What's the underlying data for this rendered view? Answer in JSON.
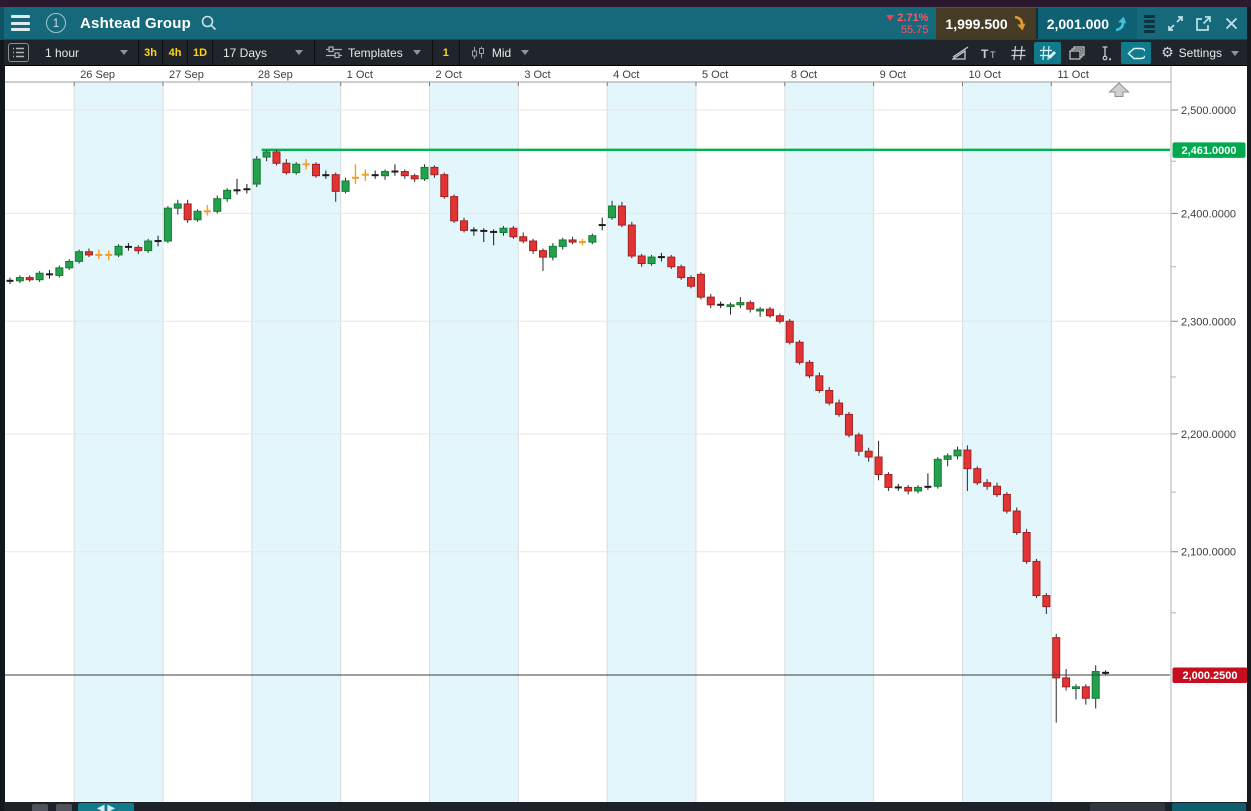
{
  "header": {
    "badge": "1",
    "title": "Ashtead Group",
    "change_glyph": "▼",
    "change_pct": "2.71%",
    "change_abs": "55.75",
    "sell": "1,999.500",
    "buy": "2,001.000",
    "accent_teal": "#15697a",
    "change_color": "#ff5560"
  },
  "toolbar": {
    "interval": "1 hour",
    "quick_intervals": [
      "3h",
      "4h",
      "1D"
    ],
    "range": "17 Days",
    "templates": "Templates",
    "count": "1",
    "price_type": "Mid",
    "settings": "Settings",
    "highlight_color": "#0f7b8c",
    "accent_yellow": "#ffd60a"
  },
  "chart_data": {
    "type": "candlestick",
    "instrument": "Ashtead Group",
    "interval": "1 hour",
    "range": "17 Days",
    "price_basis": "Mid",
    "y_axis": {
      "scale": "log",
      "ticks": [
        "2,500.0000",
        "2,400.0000",
        "2,300.0000",
        "2,200.0000",
        "2,100.0000"
      ],
      "tick_values": [
        2500,
        2400,
        2300,
        2200,
        2100
      ],
      "minor_ticks": [
        2450,
        2350,
        2250,
        2150,
        2050
      ]
    },
    "levels": {
      "high_line": {
        "value": 2461.0,
        "label": "2,461.0000",
        "line_color": "#00b34d",
        "badge_color": "#00a94e"
      },
      "last_price": {
        "value": 2000.25,
        "label": "2,000.2500",
        "line_color": "#3c3c3c",
        "badge_color": "#c50e1f"
      }
    },
    "style": {
      "up": "#23a14d",
      "up_border": "#147a35",
      "down": "#e23434",
      "down_border": "#a32121",
      "doji": "#f59d25",
      "neutral": "#1b1b1b",
      "band": "#e2f6fb",
      "grid": "#e7e7e7",
      "vgrid": "#dcdcdc",
      "wick": "#2a2a2a"
    },
    "days": [
      {
        "label": "",
        "shaded": false,
        "candles": [
          [
            2337,
            2340,
            2334,
            2337,
            "k"
          ],
          [
            2337,
            2342,
            2335,
            2340
          ],
          [
            2340,
            2342,
            2336,
            2338
          ],
          [
            2338,
            2346,
            2336,
            2344
          ],
          [
            2344,
            2347,
            2339,
            2342,
            "k"
          ],
          [
            2342,
            2351,
            2340,
            2349
          ],
          [
            2349,
            2357,
            2347,
            2355
          ]
        ]
      },
      {
        "label": "26 Sep",
        "shaded": true,
        "candles": [
          [
            2355,
            2366,
            2353,
            2364
          ],
          [
            2364,
            2367,
            2359,
            2361
          ],
          [
            2361,
            2366,
            2357,
            2361,
            "a"
          ],
          [
            2361,
            2365,
            2356,
            2361,
            "a"
          ],
          [
            2361,
            2371,
            2359,
            2369
          ],
          [
            2369,
            2372,
            2365,
            2368,
            "k"
          ],
          [
            2368,
            2370,
            2362,
            2365
          ],
          [
            2365,
            2376,
            2363,
            2374
          ],
          [
            2374,
            2379,
            2369,
            2374,
            "k"
          ]
        ]
      },
      {
        "label": "27 Sep",
        "shaded": false,
        "candles": [
          [
            2374,
            2407,
            2372,
            2405
          ],
          [
            2405,
            2413,
            2399,
            2409
          ],
          [
            2409,
            2413,
            2391,
            2394
          ],
          [
            2394,
            2404,
            2392,
            2402
          ],
          [
            2402,
            2408,
            2398,
            2402,
            "a"
          ],
          [
            2402,
            2417,
            2400,
            2414
          ],
          [
            2414,
            2424,
            2411,
            2422
          ],
          [
            2422,
            2433,
            2418,
            2422,
            "k"
          ],
          [
            2422,
            2428,
            2419,
            2424,
            "k"
          ]
        ]
      },
      {
        "label": "28 Sep",
        "shaded": true,
        "candles": [
          [
            2428,
            2455,
            2425,
            2452
          ],
          [
            2454,
            2461,
            2450,
            2459
          ],
          [
            2459,
            2461,
            2446,
            2448
          ],
          [
            2448,
            2452,
            2437,
            2439
          ],
          [
            2439,
            2449,
            2437,
            2447
          ],
          [
            2447,
            2452,
            2442,
            2447,
            "a"
          ],
          [
            2447,
            2449,
            2434,
            2436
          ],
          [
            2436,
            2441,
            2433,
            2437,
            "k"
          ],
          [
            2437,
            2439,
            2411,
            2421
          ]
        ]
      },
      {
        "label": "1 Oct",
        "shaded": false,
        "candles": [
          [
            2421,
            2434,
            2419,
            2431
          ],
          [
            2431,
            2447,
            2428,
            2437,
            "a"
          ],
          [
            2437,
            2442,
            2431,
            2437,
            "a"
          ],
          [
            2437,
            2441,
            2433,
            2436,
            "k"
          ],
          [
            2436,
            2442,
            2432,
            2440
          ],
          [
            2440,
            2447,
            2436,
            2440,
            "k"
          ],
          [
            2440,
            2442,
            2433,
            2436
          ],
          [
            2436,
            2438,
            2430,
            2433
          ],
          [
            2433,
            2447,
            2431,
            2444
          ]
        ]
      },
      {
        "label": "2 Oct",
        "shaded": true,
        "candles": [
          [
            2444,
            2446,
            2434,
            2437
          ],
          [
            2437,
            2439,
            2414,
            2416
          ],
          [
            2416,
            2418,
            2391,
            2393
          ],
          [
            2393,
            2396,
            2382,
            2384
          ],
          [
            2384,
            2387,
            2379,
            2384,
            "k"
          ],
          [
            2384,
            2386,
            2373,
            2383,
            "k"
          ],
          [
            2383,
            2385,
            2370,
            2382,
            "k"
          ],
          [
            2382,
            2388,
            2379,
            2386
          ],
          [
            2386,
            2388,
            2376,
            2378
          ]
        ]
      },
      {
        "label": "3 Oct",
        "shaded": false,
        "candles": [
          [
            2378,
            2382,
            2372,
            2374
          ],
          [
            2374,
            2376,
            2362,
            2365
          ],
          [
            2365,
            2367,
            2346,
            2359
          ],
          [
            2359,
            2372,
            2356,
            2369
          ],
          [
            2369,
            2377,
            2366,
            2375
          ],
          [
            2375,
            2378,
            2371,
            2373
          ],
          [
            2373,
            2376,
            2370,
            2373,
            "a"
          ],
          [
            2373,
            2381,
            2371,
            2379
          ],
          [
            2388,
            2396,
            2384,
            2390,
            "k"
          ]
        ]
      },
      {
        "label": "4 Oct",
        "shaded": true,
        "candles": [
          [
            2396,
            2412,
            2394,
            2407
          ],
          [
            2407,
            2411,
            2387,
            2389
          ],
          [
            2389,
            2392,
            2358,
            2360
          ],
          [
            2360,
            2362,
            2350,
            2353
          ],
          [
            2353,
            2361,
            2351,
            2359
          ],
          [
            2359,
            2363,
            2355,
            2359,
            "k"
          ],
          [
            2359,
            2361,
            2348,
            2350
          ],
          [
            2350,
            2352,
            2338,
            2340
          ],
          [
            2340,
            2342,
            2330,
            2332
          ]
        ]
      },
      {
        "label": "5 Oct",
        "shaded": false,
        "candles": [
          [
            2343,
            2345,
            2320,
            2322
          ],
          [
            2322,
            2325,
            2312,
            2315
          ],
          [
            2315,
            2318,
            2312,
            2315,
            "k"
          ],
          [
            2315,
            2317,
            2306,
            2315
          ],
          [
            2315,
            2322,
            2312,
            2317
          ],
          [
            2317,
            2319,
            2308,
            2311
          ],
          [
            2311,
            2313,
            2304,
            2311
          ],
          [
            2311,
            2313,
            2303,
            2305
          ],
          [
            2305,
            2307,
            2298,
            2300
          ]
        ]
      },
      {
        "label": "8 Oct",
        "shaded": true,
        "candles": [
          [
            2300,
            2302,
            2279,
            2281
          ],
          [
            2281,
            2283,
            2261,
            2263
          ],
          [
            2263,
            2265,
            2249,
            2251
          ],
          [
            2251,
            2254,
            2236,
            2238
          ],
          [
            2238,
            2241,
            2225,
            2227
          ],
          [
            2227,
            2230,
            2215,
            2217
          ],
          [
            2217,
            2219,
            2197,
            2199
          ],
          [
            2199,
            2201,
            2181,
            2185
          ],
          [
            2185,
            2188,
            2176,
            2180
          ]
        ]
      },
      {
        "label": "9 Oct",
        "shaded": false,
        "candles": [
          [
            2180,
            2194,
            2160,
            2165
          ],
          [
            2165,
            2167,
            2151,
            2154
          ],
          [
            2154,
            2157,
            2151,
            2154,
            "k"
          ],
          [
            2154,
            2156,
            2148,
            2151
          ],
          [
            2151,
            2156,
            2149,
            2154
          ],
          [
            2154,
            2166,
            2152,
            2155,
            "k"
          ],
          [
            2155,
            2180,
            2153,
            2178
          ],
          [
            2178,
            2183,
            2172,
            2181
          ],
          [
            2181,
            2189,
            2178,
            2186
          ]
        ]
      },
      {
        "label": "10 Oct",
        "shaded": true,
        "candles": [
          [
            2186,
            2190,
            2151,
            2170
          ],
          [
            2170,
            2172,
            2156,
            2158
          ],
          [
            2158,
            2161,
            2152,
            2155
          ],
          [
            2155,
            2158,
            2146,
            2148
          ],
          [
            2148,
            2150,
            2132,
            2134
          ],
          [
            2134,
            2137,
            2114,
            2116
          ],
          [
            2116,
            2119,
            2090,
            2092
          ],
          [
            2092,
            2094,
            2062,
            2064
          ],
          [
            2064,
            2066,
            2049,
            2055
          ]
        ]
      },
      {
        "label": "11 Oct",
        "shaded": false,
        "candles": [
          [
            2030,
            2033,
            1963,
            1998
          ],
          [
            1998,
            2005,
            1988,
            1991
          ],
          [
            1991,
            1993,
            1981,
            1991
          ],
          [
            1991,
            1993,
            1977,
            1982
          ],
          [
            1982,
            2008,
            1974,
            2003
          ],
          [
            2003,
            2004,
            2000,
            2001,
            "k"
          ]
        ]
      }
    ]
  }
}
